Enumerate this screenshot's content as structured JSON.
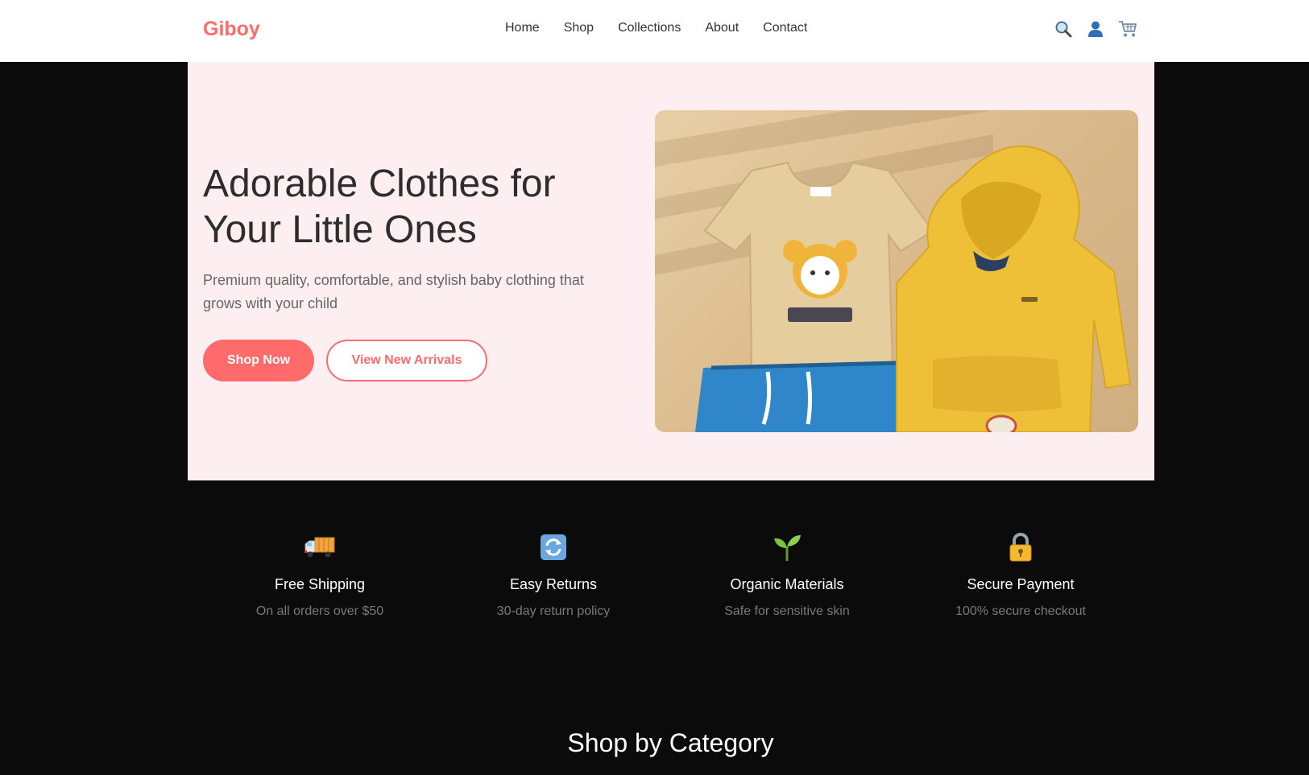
{
  "header": {
    "brand": "Giboy",
    "nav": [
      "Home",
      "Shop",
      "Collections",
      "About",
      "Contact"
    ],
    "icons": [
      "search-icon",
      "user-icon",
      "cart-icon"
    ]
  },
  "hero": {
    "title": "Adorable Clothes for Your Little Ones",
    "subtitle": "Premium quality, comfortable, and stylish baby clothing that grows with your child",
    "primary_button": "Shop Now",
    "secondary_button": "View New Arrivals"
  },
  "features": [
    {
      "icon": "truck-icon",
      "title": "Free Shipping",
      "desc": "On all orders over $50"
    },
    {
      "icon": "returns-icon",
      "title": "Easy Returns",
      "desc": "30-day return policy"
    },
    {
      "icon": "seedling-icon",
      "title": "Organic Materials",
      "desc": "Safe for sensitive skin"
    },
    {
      "icon": "lock-icon",
      "title": "Secure Payment",
      "desc": "100% secure checkout"
    }
  ],
  "section": {
    "title": "Shop by Category"
  },
  "colors": {
    "brand": "#ff6b6b",
    "hero_bg": "#fdeef1",
    "page_bg": "#0b0b0b",
    "header_bg": "#ffffff"
  }
}
